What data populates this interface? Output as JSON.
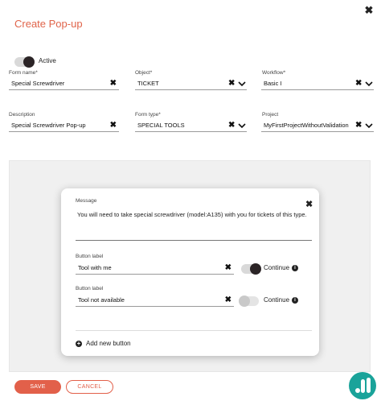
{
  "dialog": {
    "title": "Create Pop-up",
    "close_glyph": "✖"
  },
  "active": {
    "label": "Active",
    "on": true
  },
  "fields": {
    "form_name": {
      "label": "Form name*",
      "value": "Special Screwdriver"
    },
    "object": {
      "label": "Object*",
      "value": "TICKET"
    },
    "workflow": {
      "label": "Workflow*",
      "value": "Basic I"
    },
    "description": {
      "label": "Description",
      "value": "Special Screwdriver Pop-up"
    },
    "form_type": {
      "label": "Form type*",
      "value": "SPECIAL TOOLS"
    },
    "project": {
      "label": "Project",
      "value": "MyFirstProjectWithoutValidation"
    }
  },
  "popup_card": {
    "message_label": "Message",
    "message_text": "You will need to take special screwdriver (model:A135) with you for tickets of this type.",
    "buttons": [
      {
        "label": "Button label",
        "value": "Tool with me",
        "continue_label": "Continue",
        "continue_on": true
      },
      {
        "label": "Button label",
        "value": "Tool not available",
        "continue_label": "Continue",
        "continue_on": false
      }
    ],
    "add_button_label": "Add new button"
  },
  "footer": {
    "save_label": "SAVE",
    "cancel_label": "CANCEL"
  },
  "colors": {
    "accent": "#e2604a",
    "logo": "#1aa39a"
  },
  "icons": {
    "clear": "close-icon",
    "dropdown": "chevron-down-icon",
    "info": "info-icon",
    "add": "plus-circle-icon",
    "logo": "brand-logo-icon"
  }
}
